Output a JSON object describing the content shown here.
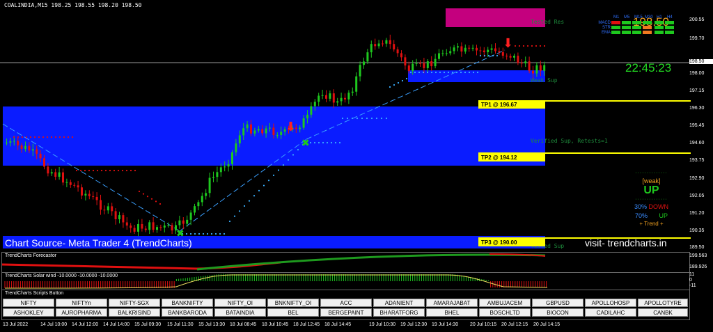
{
  "header": {
    "symbol_line": "COALINDIA,M15  198.25 198.55 198.20 198.50"
  },
  "price_display": {
    "price": "198.50",
    "clock": "22:45:23"
  },
  "price_axis": {
    "labels": [
      "200.55",
      "199.70",
      "198.50",
      "198.00",
      "197.15",
      "196.30",
      "195.45",
      "194.60",
      "193.75",
      "192.90",
      "192.05",
      "191.20",
      "190.35",
      "189.50"
    ],
    "current_price_label": "198.50"
  },
  "zones": {
    "tested_res": "Tested Res",
    "weak_sup": "Weak Sup",
    "verified_sup": "Verified Sup, Retests=1",
    "tested_sup": "Tested Sup"
  },
  "targets": {
    "tp1": "TP1 @ 196.67",
    "tp2": "TP2 @ 194.12",
    "tp3": "TP3 @ 190.00"
  },
  "mtf_panel": {
    "columns": [
      "M1",
      "M5",
      "M15",
      "M30",
      "H1",
      "H4"
    ],
    "rows": [
      "MACD",
      "STR",
      "EMA"
    ]
  },
  "trend_box": {
    "weak": "[weak]",
    "direction": "UP",
    "down_pct": "30%",
    "down_label": "DOWN",
    "up_pct": "70%",
    "up_label": "UP",
    "trend_label": "+ Trend +"
  },
  "watermark": {
    "left": "Chart Source- Meta Trader 4 (TrendCharts)",
    "right": "visit- trendcharts.in"
  },
  "forecaster": {
    "title": "TrendCharts Forecastor",
    "axis_top": "199.563",
    "axis_bottom": "189.926"
  },
  "solar_wind": {
    "title": "TrendCharts Solar wind -10.0000 -10.0000 -10.0000",
    "axis_top": "11",
    "axis_mid": "0",
    "axis_bottom": "-11"
  },
  "scripts_panel": {
    "title": "TrendCharts Scripts Button",
    "row1": [
      "NIFTY",
      "NIFTYn",
      "NIFTY-SGX",
      "BANKNIFTY",
      "NIFTY_OI",
      "BNKNIFTY_OI",
      "ACC",
      "ADANIENT",
      "AMARAJABAT",
      "AMBUJACEM",
      "GBPUSD",
      "APOLLOHOSP",
      "APOLLOTYRE"
    ],
    "row2": [
      "ASHOKLEY",
      "AUROPHARMA",
      "BALKRISIND",
      "BANKBARODA",
      "BATAINDIA",
      "BEL",
      "BERGEPAINT",
      "BHARATFORG",
      "BHEL",
      "BOSCHLTD",
      "BIOCON",
      "CADILAHC",
      "CANBK"
    ]
  },
  "time_axis": [
    "13 Jul 2022",
    "14 Jul 10:00",
    "14 Jul 12:00",
    "14 Jul 14:00",
    "15 Jul 09:30",
    "15 Jul 11:30",
    "15 Jul 13:30",
    "18 Jul 08:45",
    "18 Jul 10:45",
    "18 Jul 12:45",
    "18 Jul 14:45",
    "19 Jul 10:30",
    "19 Jul 12:30",
    "19 Jul 14:30",
    "20 Jul 10:15",
    "20 Jul 12:15",
    "20 Jul 14:15"
  ],
  "colors": {
    "bull": "#1ec81e",
    "bear": "#e01010",
    "zone_blue": "#0a1cff",
    "zone_magenta": "#c4007e",
    "tp_yellow": "#ffff00"
  }
}
